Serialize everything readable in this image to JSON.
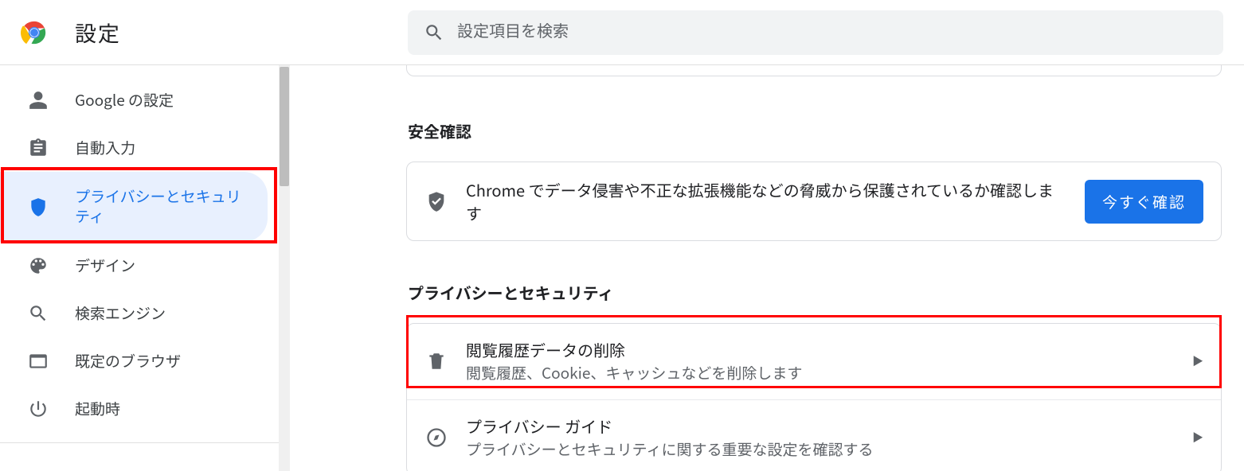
{
  "header": {
    "title": "設定",
    "search_placeholder": "設定項目を検索"
  },
  "sidebar": {
    "items": [
      {
        "id": "google",
        "label": "Google の設定"
      },
      {
        "id": "autofill",
        "label": "自動入力"
      },
      {
        "id": "privacy",
        "label": "プライバシーとセキュリティ",
        "selected": true
      },
      {
        "id": "design",
        "label": "デザイン"
      },
      {
        "id": "search",
        "label": "検索エンジン"
      },
      {
        "id": "default",
        "label": "既定のブラウザ"
      },
      {
        "id": "startup",
        "label": "起動時"
      }
    ]
  },
  "main": {
    "safety": {
      "heading": "安全確認",
      "description": "Chrome でデータ侵害や不正な拡張機能などの脅威から保護されているか確認します",
      "button": "今すぐ確認"
    },
    "privacy": {
      "heading": "プライバシーとセキュリティ",
      "rows": [
        {
          "id": "clear-data",
          "title": "閲覧履歴データの削除",
          "sub": "閲覧履歴、Cookie、キャッシュなどを削除します",
          "highlighted": true
        },
        {
          "id": "privacy-guide",
          "title": "プライバシー ガイド",
          "sub": "プライバシーとセキュリティに関する重要な設定を確認する"
        }
      ]
    }
  }
}
